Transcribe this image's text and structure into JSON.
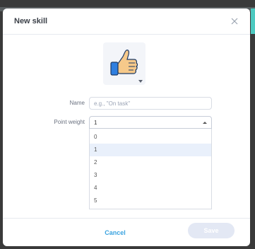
{
  "dialog": {
    "title": "New skill",
    "icon_name": "thumbs-up-icon",
    "name_label": "Name",
    "name_value": "",
    "name_placeholder": "e.g., \"On task\"",
    "point_weight_label": "Point weight",
    "point_weight_selected": "1",
    "point_weight_options": [
      "0",
      "1",
      "2",
      "3",
      "4",
      "5"
    ],
    "cancel_label": "Cancel",
    "save_label": "Save"
  },
  "colors": {
    "accent": "#3aa3e0",
    "save_disabled": "#e3e8f4",
    "option_highlight": "#e9f0fb"
  }
}
